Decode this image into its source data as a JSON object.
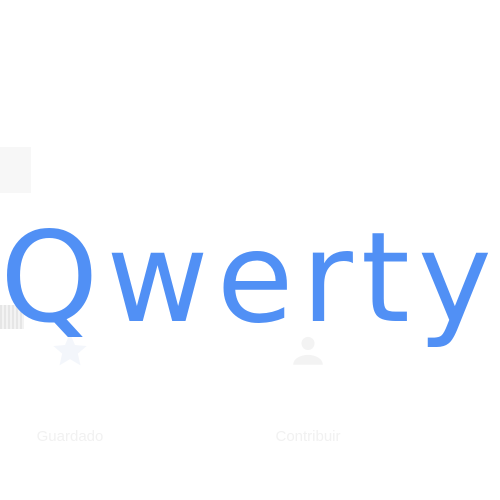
{
  "bottom_nav": {
    "items": [
      {
        "label": "Guardado",
        "icon": "star-icon"
      },
      {
        "label": "Contribuir",
        "icon": "add-person-icon"
      }
    ]
  },
  "handwriting": {
    "text": "Qwerty",
    "color": "#5190f5"
  }
}
